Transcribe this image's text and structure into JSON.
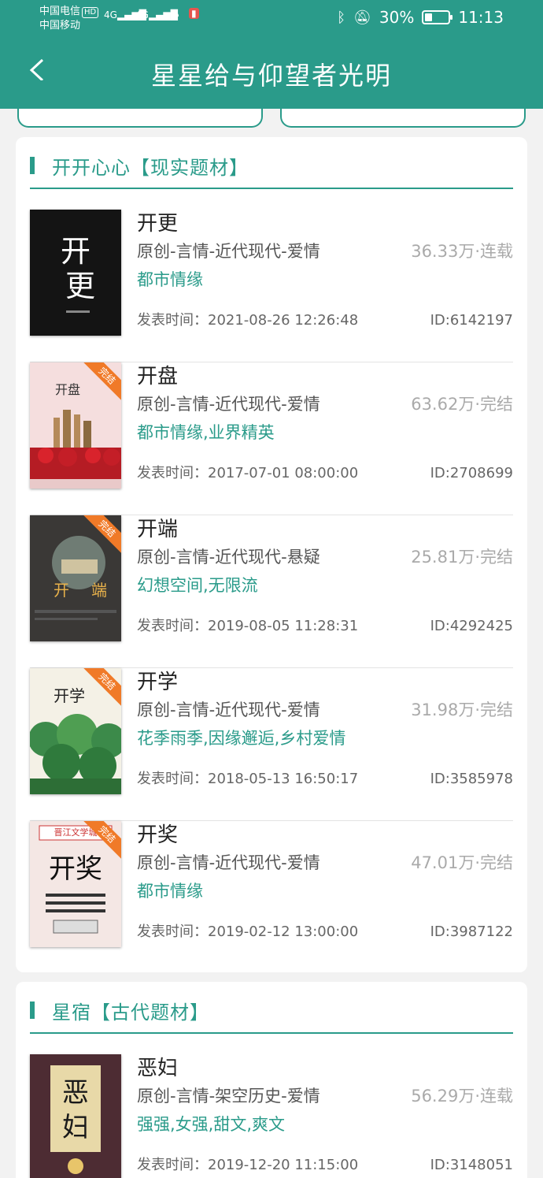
{
  "status": {
    "carrier1": "中国电信",
    "hd": "HD",
    "carrier2": "中国移动",
    "net1": "4G",
    "net2": "4G",
    "battery": "30%",
    "time": "11:13"
  },
  "header": {
    "title": "星星给与仰望者光明"
  },
  "sections": [
    {
      "title": "开开心心【现实题材】",
      "books": [
        {
          "title": "开更",
          "category": "原创-言情-近代现代-爱情",
          "stats": "36.33万·连载",
          "tags": "都市情缘",
          "time": "发表时间：2021-08-26 12:26:48",
          "id": "ID:6142197",
          "cover_text": "开更",
          "complete": ""
        },
        {
          "title": "开盘",
          "category": "原创-言情-近代现代-爱情",
          "stats": "63.62万·完结",
          "tags": "都市情缘,业界精英",
          "time": "发表时间：2017-07-01 08:00:00",
          "id": "ID:2708699",
          "cover_text": "开盘",
          "complete": "完结"
        },
        {
          "title": "开端",
          "category": "原创-言情-近代现代-悬疑",
          "stats": "25.81万·完结",
          "tags": "幻想空间,无限流",
          "time": "发表时间：2019-08-05 11:28:31",
          "id": "ID:4292425",
          "cover_text": "开端",
          "complete": "完结"
        },
        {
          "title": "开学",
          "category": "原创-言情-近代现代-爱情",
          "stats": "31.98万·完结",
          "tags": "花季雨季,因缘邂逅,乡村爱情",
          "time": "发表时间：2018-05-13 16:50:17",
          "id": "ID:3585978",
          "cover_text": "开学",
          "complete": "完结"
        },
        {
          "title": "开奖",
          "category": "原创-言情-近代现代-爱情",
          "stats": "47.01万·完结",
          "tags": "都市情缘",
          "time": "发表时间：2019-02-12 13:00:00",
          "id": "ID:3987122",
          "cover_text": "开奖",
          "complete": "完结",
          "cover_top": "晋江文学城"
        }
      ]
    },
    {
      "title": "星宿【古代题材】",
      "books": [
        {
          "title": "恶妇",
          "category": "原创-言情-架空历史-爱情",
          "stats": "56.29万·连载",
          "tags": "强强,女强,甜文,爽文",
          "time": "发表时间：2019-12-20 11:15:00",
          "id": "ID:3148051",
          "cover_text": "恶妇",
          "complete": ""
        }
      ]
    }
  ]
}
